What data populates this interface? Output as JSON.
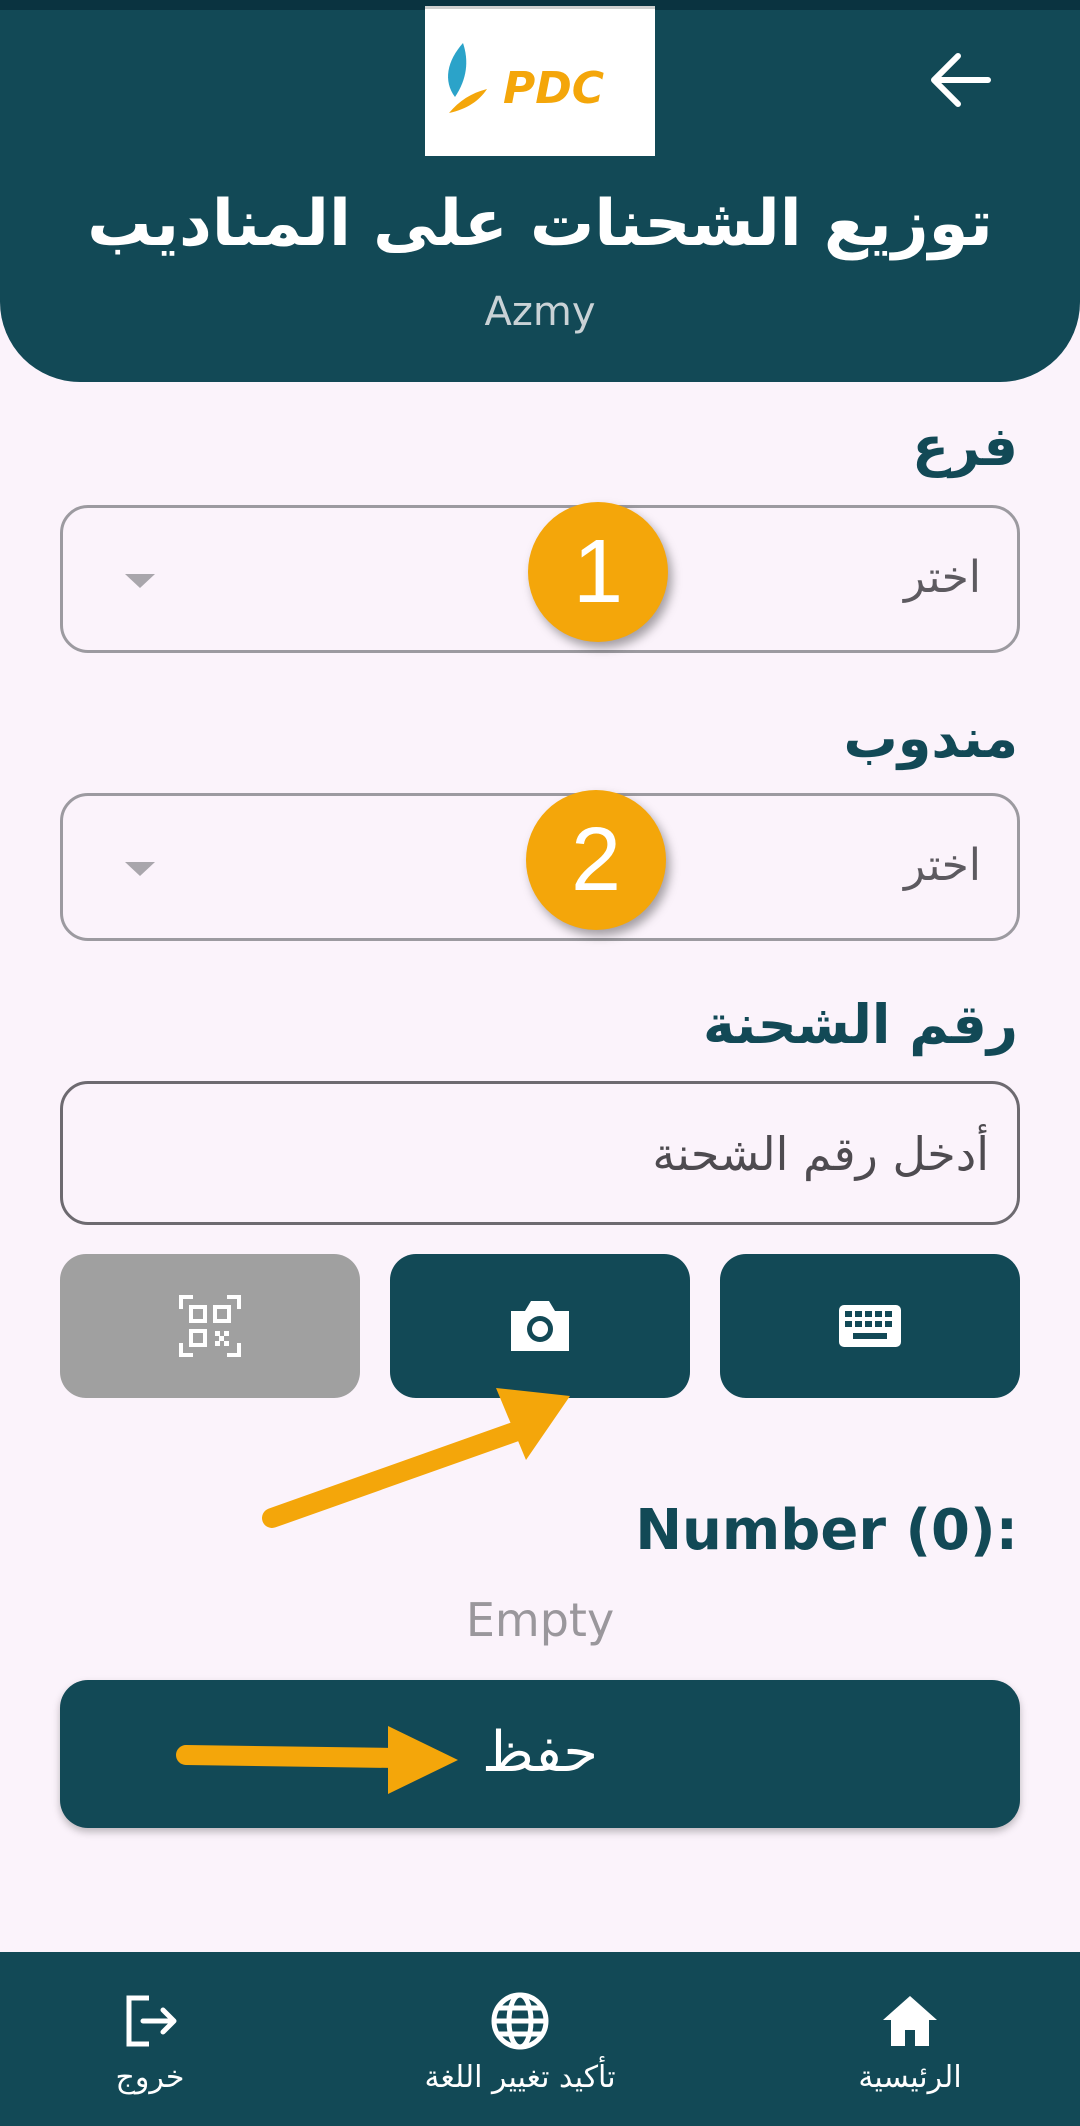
{
  "header": {
    "logo_text": "PDC",
    "title": "توزيع الشحنات على المناديب",
    "subtitle": "Azmy",
    "back_icon": "arrow-back-icon"
  },
  "form": {
    "branch": {
      "label": "فرع",
      "value": "اختر",
      "step_number": "1"
    },
    "agent": {
      "label": "مندوب",
      "value": "اختر",
      "step_number": "2"
    },
    "shipment": {
      "label": "رقم الشحنة",
      "placeholder": "أدخل رقم الشحنة"
    },
    "input_modes": [
      {
        "icon": "keyboard-icon",
        "enabled": true
      },
      {
        "icon": "camera-icon",
        "enabled": true
      },
      {
        "icon": "qr-code-icon",
        "enabled": false
      }
    ],
    "count_label": "Number (0):",
    "empty_text": "Empty",
    "save_label": "حفظ"
  },
  "annotation_color": "#f4a60a",
  "accent_color": "#124956",
  "bottom_nav": {
    "items": [
      {
        "label": "الرئيسية",
        "icon": "home-icon"
      },
      {
        "label": "تأكيد تغيير اللغة",
        "icon": "globe-icon"
      },
      {
        "label": "خروج",
        "icon": "logout-icon"
      }
    ]
  }
}
